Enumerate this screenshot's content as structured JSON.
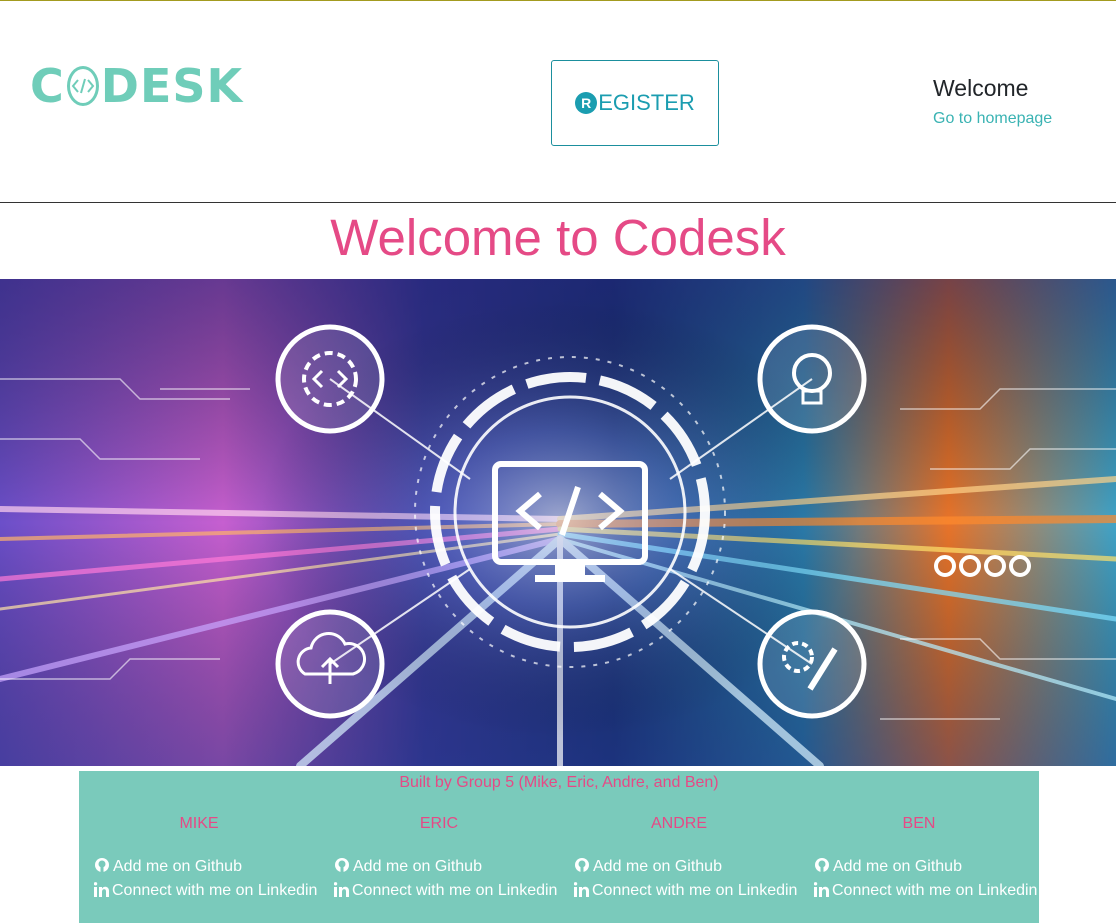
{
  "header": {
    "logo_left": "C",
    "logo_right": "DESK",
    "register_badge": "R",
    "register_label": "EGISTER",
    "welcome_title": "Welcome",
    "home_link": "Go to homepage"
  },
  "hero": {
    "title": "Welcome to Codesk"
  },
  "footer": {
    "built_by": "Built by Group 5 (Mike, Eric, Andre, and Ben)",
    "members": [
      {
        "name": "MIKE",
        "github": "Add me on Github",
        "linkedin": "Connect with me on Linkedin"
      },
      {
        "name": "ERIC",
        "github": "Add me on Github",
        "linkedin": "Connect with me on Linkedin"
      },
      {
        "name": "ANDRE",
        "github": "Add me on Github",
        "linkedin": "Connect with me on Linkedin"
      },
      {
        "name": "BEN",
        "github": "Add me on Github",
        "linkedin": "Connect with me on Linkedin"
      }
    ]
  },
  "colors": {
    "brand_teal": "#6fcdb9",
    "accent_pink": "#e54a86",
    "footer_bg": "#7acabb",
    "register_blue": "#1b9db0"
  },
  "icons": [
    "code-icon",
    "register-badge-icon",
    "gear-code-icon",
    "lightbulb-icon",
    "cloud-upload-icon",
    "gear-pencil-icon",
    "monitor-code-icon",
    "github-icon",
    "linkedin-icon"
  ]
}
